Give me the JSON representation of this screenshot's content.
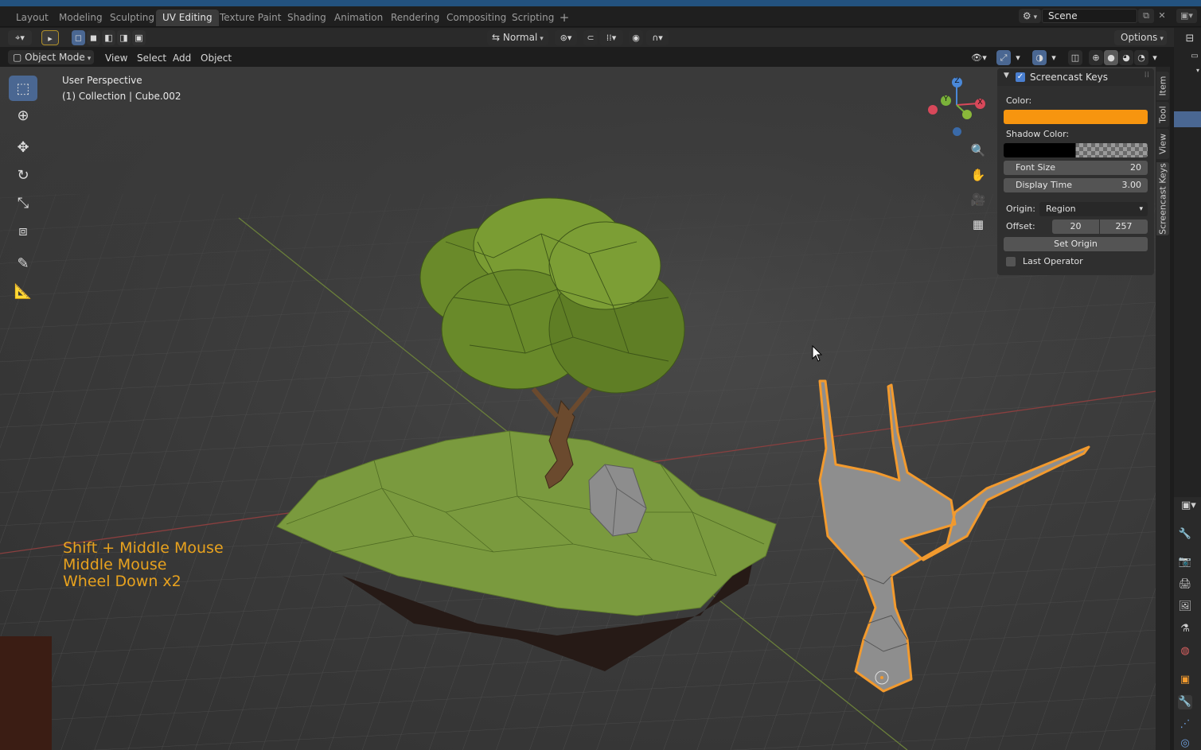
{
  "workspace_tabs": [
    "Layout",
    "Modeling",
    "Sculpting",
    "UV Editing",
    "Texture Paint",
    "Shading",
    "Animation",
    "Rendering",
    "Compositing",
    "Scripting"
  ],
  "active_tab": "UV Editing",
  "add_tab_icon": "+",
  "scene": {
    "label": "Scene",
    "icon": "scene-icon"
  },
  "header": {
    "transform_orientation": "Normal",
    "options_label": "Options"
  },
  "viewport_header": {
    "mode": "Object Mode",
    "menus": [
      "View",
      "Select",
      "Add",
      "Object"
    ]
  },
  "viewport_info": {
    "perspective": "User Perspective",
    "collection": "(1) Collection | Cube.002"
  },
  "gizmo": {
    "x": "X",
    "y": "Y",
    "z": "Z"
  },
  "screencast_panel": {
    "title": "Screencast Keys",
    "enabled": true,
    "color_label": "Color:",
    "color_value": "#f7950f",
    "shadow_color_label": "Shadow Color:",
    "shadow_color_value": "#000000",
    "font_size_label": "Font Size",
    "font_size_value": "20",
    "display_time_label": "Display Time",
    "display_time_value": "3.00",
    "origin_label": "Origin:",
    "origin_value": "Region",
    "offset_label": "Offset:",
    "offset_x": "20",
    "offset_y": "257",
    "set_origin_label": "Set Origin",
    "last_operator_label": "Last Operator",
    "last_operator_checked": false
  },
  "sidebar_tabs": [
    "Item",
    "Tool",
    "View",
    "Screencast Keys"
  ],
  "active_sidebar_tab": "Screencast Keys",
  "screencast_keys": [
    "Shift + Middle Mouse",
    "Middle Mouse",
    "Wheel Down x2"
  ],
  "colors": {
    "accent": "#4a6792",
    "key_text": "#e8a21e",
    "selection_outline": "#f29a2e",
    "ground": "#7a9a3e"
  }
}
